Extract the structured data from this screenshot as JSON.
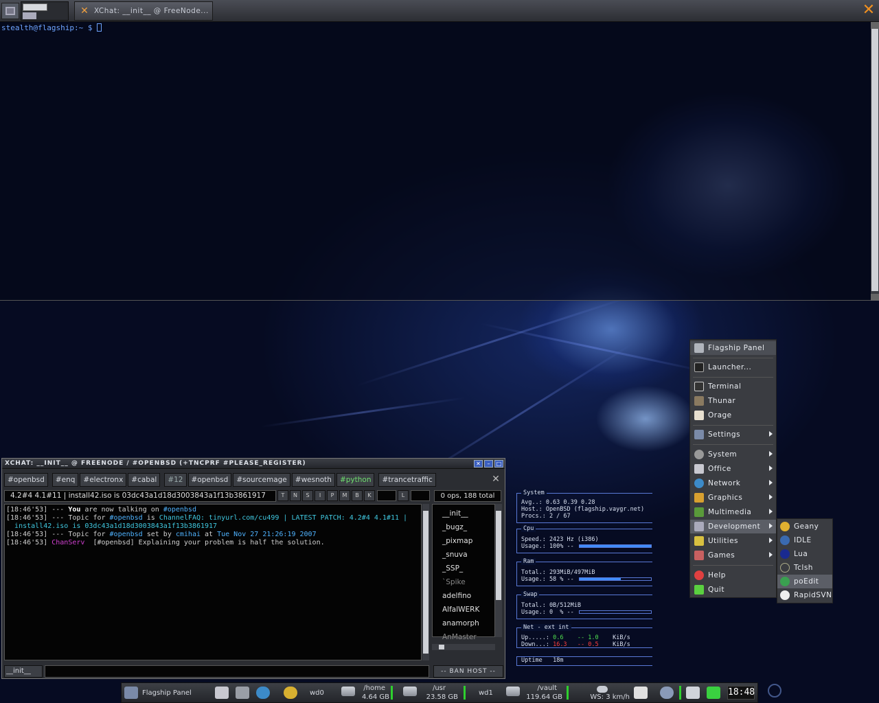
{
  "top_panel": {
    "task_title": "XChat: __init__ @ FreeNode..."
  },
  "terminal": {
    "prompt": "stealth@flagship:~ $ "
  },
  "xchat": {
    "title": "XCHAT: __INIT__ @ FREENODE / #OPENBSD (+TNCPRF #PLEASE_REGISTER)",
    "tabs": [
      {
        "label": "#openbsd",
        "state": "normal"
      },
      {
        "label": "#enq",
        "state": "normal"
      },
      {
        "label": "#electronx",
        "state": "normal"
      },
      {
        "label": "#cabal",
        "state": "normal"
      },
      {
        "label": "#12",
        "state": "server"
      },
      {
        "label": "#openbsd",
        "state": "normal"
      },
      {
        "label": "#sourcemage",
        "state": "normal"
      },
      {
        "label": "#wesnoth",
        "state": "normal"
      },
      {
        "label": "#python",
        "state": "active"
      },
      {
        "label": "#trancetraffic",
        "state": "normal"
      }
    ],
    "topic": "4.2#4 4.1#11 | install42.iso is 03dc43a1d18d3003843a1f13b3861917",
    "mode_buttons": [
      "T",
      "N",
      "S",
      "I",
      "P",
      "M",
      "B",
      "K"
    ],
    "limit_button": "L",
    "ops_count": "0 ops, 188 total",
    "messages": {
      "l1_ts": "[18:46'53]",
      "l1_a": " --- ",
      "l1_you": "You",
      "l1_b": " are now talking on ",
      "l1_chan": "#openbsd",
      "l2_ts": "[18:46'53]",
      "l2_a": " --- Topic for ",
      "l2_chan": "#openbsd",
      "l2_b": " is ",
      "l2_topic1": "ChannelFAQ: tinyurl.com/cu499 | LATEST PATCH: 4.2#4 4.1#11 |",
      "l2_topic2": "install42.iso is 03dc43a1d18d3003843a1f13b3861917",
      "l3_ts": "[18:46'53]",
      "l3_a": " --- Topic for ",
      "l3_chan": "#openbsd",
      "l3_b": " set by ",
      "l3_nick": "cmihai",
      "l3_c": " at ",
      "l3_date": "Tue Nov 27 21:26:19 2007",
      "l4_ts": "[18:46'53]",
      "l4_nick": " ChanServ ",
      "l4_text": " [#openbsd] Explaining your problem is half the solution."
    },
    "nicklist": [
      "__init__",
      "_bugz_",
      "_pixmap",
      "_snuva",
      "_SSP_",
      "`Spike",
      "adelfino",
      "AlfalWERK",
      "anamorph",
      "AnMaster"
    ],
    "nick_button": "__init__",
    "ban_button": "-- BAN HOST --"
  },
  "conky": {
    "system": {
      "header": "System",
      "avg": "Avg..: 0.63 0.39 0.28",
      "host": "Host.: OpenBSD (flagship.vaygr.net)",
      "procs": "Procs.: 2 / 67"
    },
    "cpu": {
      "header": "Cpu",
      "speed": "Speed.: 2423 Hz (i386)",
      "usage": "Usage.: 100% --",
      "usage_fraction": 1.0
    },
    "ram": {
      "header": "Ram",
      "total": "Total.: 293MiB/497MiB",
      "usage": "Usage.: 58 % --",
      "usage_fraction": 0.58
    },
    "swap": {
      "header": "Swap",
      "total": "Total.: 0B/512MiB",
      "usage": "Usage.: 0  % --",
      "usage_fraction": 0.0
    },
    "net": {
      "header": "Net  -  ext        int",
      "up_label": "Up.....:",
      "up_ext": "0.6",
      "up_int": "1.0",
      "up_unit": "KiB/s",
      "down_label": "Down...:",
      "down_ext": "16.3",
      "down_int": "0.5",
      "down_unit": "KiB/s"
    },
    "uptime": {
      "label": "Uptime",
      "value": "18m"
    }
  },
  "menu": {
    "header": "Flagship Panel",
    "items": [
      {
        "label": "Launcher...",
        "icon": "launcher-icon"
      },
      {
        "label": "Terminal",
        "icon": "terminal-icon"
      },
      {
        "label": "Thunar",
        "icon": "thunar-icon"
      },
      {
        "label": "Orage",
        "icon": "orage-icon"
      },
      {
        "label": "Settings",
        "icon": "settings-icon"
      },
      {
        "label": "System",
        "icon": "system-icon"
      },
      {
        "label": "Office",
        "icon": "office-icon"
      },
      {
        "label": "Network",
        "icon": "network-icon"
      },
      {
        "label": "Graphics",
        "icon": "graphics-icon"
      },
      {
        "label": "Multimedia",
        "icon": "multimedia-icon"
      },
      {
        "label": "Development",
        "icon": "development-icon"
      },
      {
        "label": "Utilities",
        "icon": "utilities-icon"
      },
      {
        "label": "Games",
        "icon": "games-icon"
      },
      {
        "label": "Help",
        "icon": "help-icon"
      },
      {
        "label": "Quit",
        "icon": "quit-icon"
      }
    ],
    "submenu": [
      "Geany",
      "IDLE",
      "Lua",
      "Tclsh",
      "poEdit",
      "RapidSVN"
    ]
  },
  "bottom_panel": {
    "flagship_label": "Flagship Panel",
    "wd0": "wd0",
    "home_path": "/home",
    "home_size": "4.64 GB",
    "usr_path": "/usr",
    "usr_size": "23.58 GB",
    "wd1": "wd1",
    "vault_path": "/vault",
    "vault_size": "119.64 GB",
    "weather": "WS: 3 km/h",
    "clock": "18:48"
  }
}
